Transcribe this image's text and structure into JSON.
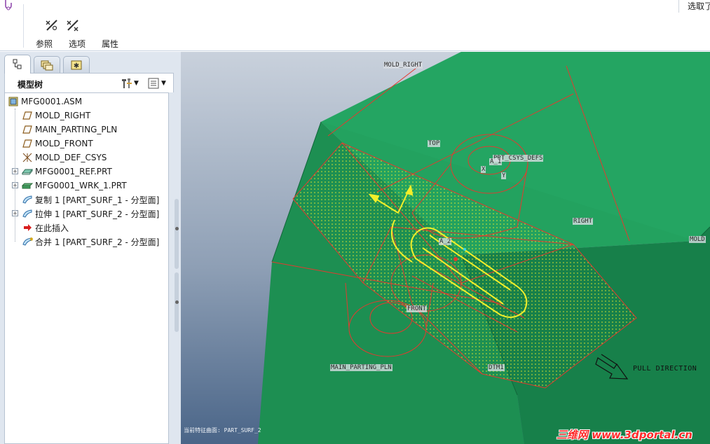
{
  "ribbon": {
    "tools": [
      {
        "name": "references-tool",
        "label": "参照",
        "icon": "references-icon"
      },
      {
        "name": "options-tool",
        "label": "选项",
        "icon": "options-icon"
      },
      {
        "name": "properties-tool",
        "label": "属性",
        "icon": "properties-icon"
      }
    ],
    "select_label": "选取了"
  },
  "left_panel": {
    "tabs": [
      {
        "name": "model-tree-tab",
        "icon": "tree-icon",
        "active": true
      },
      {
        "name": "folder-browser-tab",
        "icon": "folder-icon",
        "active": false
      },
      {
        "name": "favorites-tab",
        "icon": "star-icon",
        "active": false
      }
    ],
    "title": "模型树",
    "tree": [
      {
        "label": "MFG0001.ASM",
        "icon": "assembly-icon",
        "indent": 0,
        "expander": false
      },
      {
        "label": "MOLD_RIGHT",
        "icon": "datum-plane-icon",
        "indent": 1,
        "expander": false
      },
      {
        "label": "MAIN_PARTING_PLN",
        "icon": "datum-plane-icon",
        "indent": 1,
        "expander": false
      },
      {
        "label": "MOLD_FRONT",
        "icon": "datum-plane-icon",
        "indent": 1,
        "expander": false
      },
      {
        "label": "MOLD_DEF_CSYS",
        "icon": "csys-icon",
        "indent": 1,
        "expander": false
      },
      {
        "label": "MFG0001_REF.PRT",
        "icon": "part-icon",
        "indent": 1,
        "expander": true
      },
      {
        "label": "MFG0001_WRK_1.PRT",
        "icon": "workpiece-icon",
        "indent": 1,
        "expander": true
      },
      {
        "label": "复制 1 [PART_SURF_1 - 分型面]",
        "icon": "surface-icon",
        "indent": 1,
        "expander": false
      },
      {
        "label": "拉伸 1 [PART_SURF_2 - 分型面]",
        "icon": "surface-icon",
        "indent": 1,
        "expander": true
      },
      {
        "label": "在此插入",
        "icon": "insert-arrow-icon",
        "indent": 1,
        "expander": false
      },
      {
        "label": "合并 1 [PART_SURF_2 - 分型面]",
        "icon": "merge-surface-icon",
        "indent": 1,
        "expander": false
      }
    ]
  },
  "viewport": {
    "labels": {
      "mold_right": "MOLD_RIGHT",
      "top": "TOP",
      "prt_csys_def": "PRT_CSYS_DEFS",
      "a_1": "A_1",
      "x": "X",
      "y": "Y",
      "right": "RIGHT",
      "mold_front": "MOLD",
      "a_2": "A_2",
      "front": "FRONT",
      "main_parting_pln": "MAIN_PARTING_PLN",
      "dtm1": "DTM1"
    },
    "pull_direction": "PULL DIRECTION",
    "status_note": "当前特征曲面: PART_SURF_2",
    "watermark": "三维网 www.3dportal.cn"
  },
  "colors": {
    "ribbon_bg": "#ffffff",
    "panel_bg": "#dfe6ef",
    "viewport_bg_top": "#c9d1dc",
    "viewport_bg_bottom": "#4a6588",
    "workpiece_green": "#1f9a5c",
    "parting_surface_yellow": "#f2ef2a",
    "part_outline_red": "#e33a2f"
  }
}
